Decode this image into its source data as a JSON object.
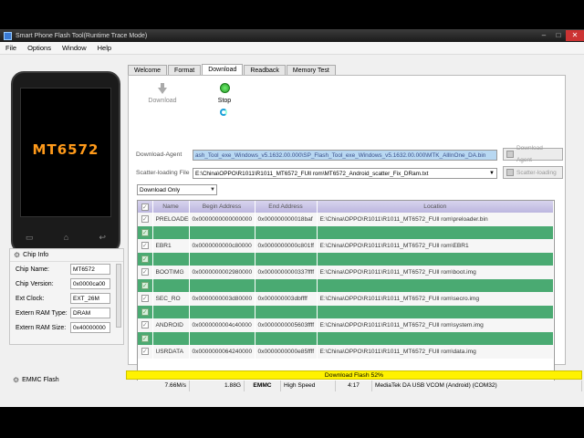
{
  "window": {
    "title": "Smart Phone Flash Tool(Runtime Trace Mode)",
    "controls": {
      "minimize": "–",
      "maximize": "□",
      "close": "✕"
    }
  },
  "menu": [
    "File",
    "Options",
    "Window",
    "Help"
  ],
  "phone": {
    "chip_label": "MT6572",
    "keys": {
      "back": "▭",
      "home": "⌂",
      "menu": "↩"
    }
  },
  "chip_info": {
    "title": "Chip Info",
    "rows": [
      {
        "label": "Chip Name:",
        "value": "MT6572"
      },
      {
        "label": "Chip Version:",
        "value": "0x0000ca00"
      },
      {
        "label": "Ext Clock:",
        "value": "EXT_26M"
      },
      {
        "label": "Extern RAM Type:",
        "value": "DRAM"
      },
      {
        "label": "Extern RAM Size:",
        "value": "0x40000000"
      }
    ]
  },
  "emmc": {
    "label": "EMMC Flash"
  },
  "tabs": [
    "Welcome",
    "Format",
    "Download",
    "Readback",
    "Memory Test"
  ],
  "active_tab": "Download",
  "toolbar": {
    "download_label": "Download",
    "stop_label": "Stop"
  },
  "download_agent": {
    "label": "Download-Agent",
    "path": "ash_Tool_exe_Windows_v5.1632.00.000\\SP_Flash_Tool_exe_Windows_v5.1632.00.000\\MTK_AllInOne_DA.bin",
    "button": "Download Agent"
  },
  "scatter": {
    "label": "Scatter-loading File",
    "path": "E:\\China\\OPPO\\R1011\\R1011_MT6572_FUll rom\\MT6572_Android_scatter_Fix_DRam.txt",
    "button": "Scatter-loading"
  },
  "mode": {
    "selected": "Download Only"
  },
  "table": {
    "headers": [
      "",
      "Name",
      "Begin Address",
      "End Address",
      "Location"
    ],
    "rows": [
      {
        "checked": true,
        "name": "PRELOADER",
        "begin": "0x0000000000000000",
        "end": "0x000000000018baf",
        "location": "E:\\China\\OPPO\\R1011\\R1011_MT6572_FUll rom\\preloader.bin"
      },
      {
        "checked": true,
        "name": "",
        "begin": "",
        "end": "",
        "location": ""
      },
      {
        "checked": true,
        "name": "EBR1",
        "begin": "0x0000000000c80000",
        "end": "0x0000000000c801ff",
        "location": "E:\\China\\OPPO\\R1011\\R1011_MT6572_FUll rom\\EBR1"
      },
      {
        "checked": true,
        "name": "",
        "begin": "",
        "end": "",
        "location": ""
      },
      {
        "checked": true,
        "name": "BOOTIMG",
        "begin": "0x0000000002980000",
        "end": "0x0000000000337ffff",
        "location": "E:\\China\\OPPO\\R1011\\R1011_MT6572_FUll rom\\boot.img"
      },
      {
        "checked": true,
        "name": "",
        "begin": "",
        "end": "",
        "location": ""
      },
      {
        "checked": true,
        "name": "SEC_RO",
        "begin": "0x0000000003d80000",
        "end": "0x000000003dbffff",
        "location": "E:\\China\\OPPO\\R1011\\R1011_MT6572_FUll rom\\secro.img"
      },
      {
        "checked": true,
        "name": "",
        "begin": "",
        "end": "",
        "location": ""
      },
      {
        "checked": true,
        "name": "ANDROID",
        "begin": "0x0000000004c40000",
        "end": "0x0000000005603ffff",
        "location": "E:\\China\\OPPO\\R1011\\R1011_MT6572_FUll rom\\system.img"
      },
      {
        "checked": true,
        "name": "",
        "begin": "",
        "end": "",
        "location": ""
      },
      {
        "checked": true,
        "name": "USRDATA",
        "begin": "0x0000000064240000",
        "end": "0x0000000000e85ffff",
        "location": "E:\\China\\OPPO\\R1011\\R1011_MT6572_FUll rom\\data.img"
      }
    ]
  },
  "progress": {
    "text": "Download Flash 52%",
    "percent": 52,
    "color": "#fff200"
  },
  "status": [
    "7.66M/s",
    "1.88G",
    "EMMC",
    "High Speed",
    "4:17",
    "MediaTek DA USB VCOM (Android) (COM32)"
  ]
}
